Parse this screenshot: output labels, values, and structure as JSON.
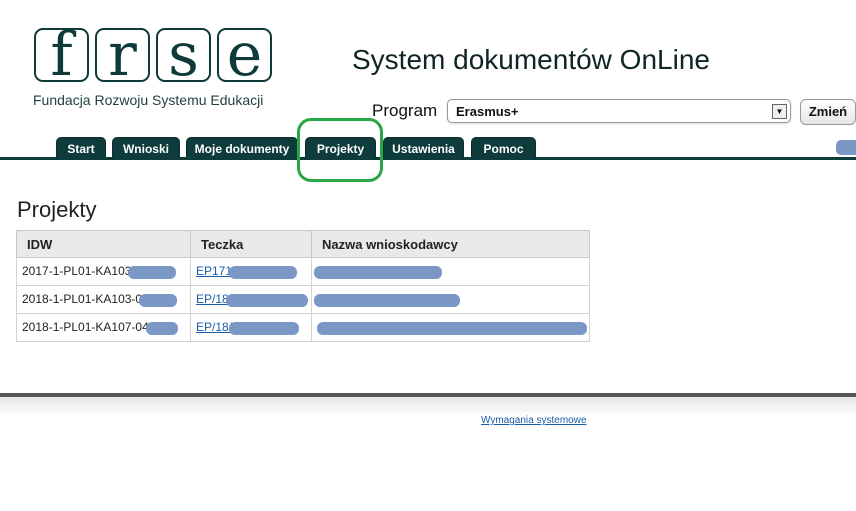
{
  "logo": {
    "letters": [
      "f",
      "r",
      "s",
      "e"
    ],
    "subtitle": "Fundacja Rozwoju Systemu Edukacji"
  },
  "header": {
    "title": "System dokumentów OnLine"
  },
  "program": {
    "label": "Program",
    "selected": "Erasmus+",
    "change_button": "Zmień"
  },
  "nav": {
    "tabs": [
      "Start",
      "Wnioski",
      "Moje dokumenty",
      "Projekty",
      "Ustawienia",
      "Pomoc"
    ],
    "active": "Projekty"
  },
  "page": {
    "title": "Projekty"
  },
  "table": {
    "headers": [
      "IDW",
      "Teczka",
      "Nazwa wnioskodawcy"
    ],
    "rows": [
      {
        "idw": "2017-1-PL01-KA103",
        "teczka": "EP171"
      },
      {
        "idw": "2018-1-PL01-KA103-0",
        "teczka": "EP/18"
      },
      {
        "idw": "2018-1-PL01-KA107-04",
        "teczka": "EP/18/"
      }
    ]
  },
  "footer": {
    "link": "Wymagania systemowe"
  },
  "colors": {
    "nav": "#0e3c3c",
    "highlight": "#27a845",
    "redaction": "#7a97c6",
    "link": "#1a5ca8"
  }
}
